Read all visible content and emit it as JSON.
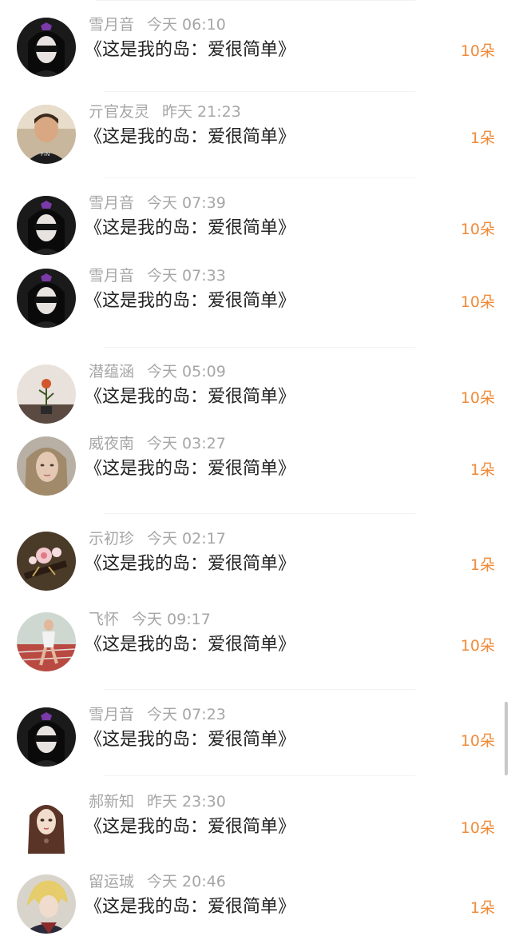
{
  "gift_records": [
    {
      "name": "雪月音",
      "time": "今天 06:10",
      "gift": "《这是我的岛：爱很简单》",
      "count": "10朵",
      "avatar": "black-hair-girl-icon"
    },
    {
      "name": "亓官友灵",
      "time": "昨天 21:23",
      "gift": "《这是我的岛：爱很简单》",
      "count": "1朵",
      "avatar": "boy-photo-icon"
    },
    {
      "name": "雪月音",
      "time": "今天 07:39",
      "gift": "《这是我的岛：爱很简单》",
      "count": "10朵",
      "avatar": "black-hair-girl-icon"
    },
    {
      "name": "雪月音",
      "time": "今天 07:33",
      "gift": "《这是我的岛：爱很简单》",
      "count": "10朵",
      "avatar": "black-hair-girl-icon"
    },
    {
      "name": "潜蕴涵",
      "time": "今天 05:09",
      "gift": "《这是我的岛：爱很简单》",
      "count": "10朵",
      "avatar": "rose-vase-icon"
    },
    {
      "name": "威夜南",
      "time": "今天 03:27",
      "gift": "《这是我的岛：爱很简单》",
      "count": "1朵",
      "avatar": "blonde-girl-icon"
    },
    {
      "name": "示初珍",
      "time": "今天 02:17",
      "gift": "《这是我的岛：爱很简单》",
      "count": "1朵",
      "avatar": "flower-hairpin-icon"
    },
    {
      "name": "飞怀",
      "time": "今天 09:17",
      "gift": "《这是我的岛：爱很简单》",
      "count": "10朵",
      "avatar": "runner-girl-icon"
    },
    {
      "name": "雪月音",
      "time": "今天 07:23",
      "gift": "《这是我的岛：爱很简单》",
      "count": "10朵",
      "avatar": "black-hair-girl-icon"
    },
    {
      "name": "郝新知",
      "time": "昨天 23:30",
      "gift": "《这是我的岛：爱很简单》",
      "count": "10朵",
      "avatar": "anime-girl-icon"
    },
    {
      "name": "留运珹",
      "time": "今天 20:46",
      "gift": "《这是我的岛：爱很简单》",
      "count": "1朵",
      "avatar": "blonde-anime-boy-icon"
    }
  ],
  "colors": {
    "name_time": "#a6a6a6",
    "gift_text": "#222222",
    "flower_count": "#f08a38",
    "separator": "#f3f3f3"
  }
}
